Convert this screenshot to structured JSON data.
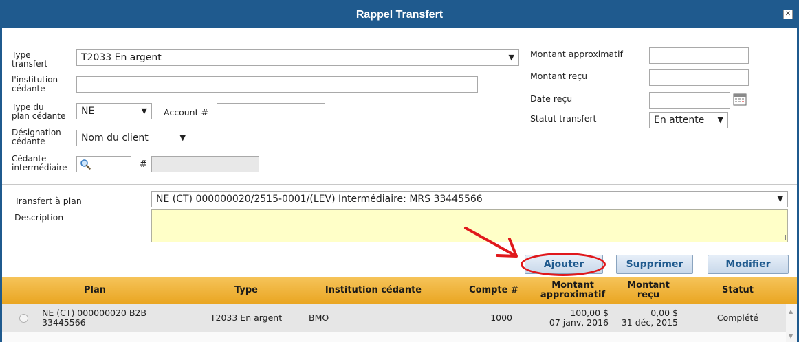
{
  "dialog": {
    "title": "Rappel Transfert",
    "close_glyph": "✕"
  },
  "form": {
    "type_transfert": {
      "label1": "Type",
      "label2": "transfert",
      "value": "T2033 En argent"
    },
    "institution_cedante": {
      "label1": "l'institution",
      "label2": "cédante",
      "value": ""
    },
    "type_plan_cedante": {
      "label1": "Type du",
      "label2": "plan cédante",
      "value": "NE"
    },
    "account": {
      "label": "Account #",
      "value": ""
    },
    "designation_cedante": {
      "label1": "Désignation",
      "label2": "cédante",
      "value": "Nom du client"
    },
    "cedante_intermediaire": {
      "label1": "Cédante",
      "label2": "intermédiaire",
      "hash": "#",
      "value": "",
      "number": ""
    },
    "montant_approximatif": {
      "label": "Montant approximatif",
      "value": ""
    },
    "montant_recu": {
      "label": "Montant reçu",
      "value": ""
    },
    "date_recu": {
      "label": "Date reçu",
      "value": ""
    },
    "statut_transfert": {
      "label": "Statut transfert",
      "value": "En attente"
    },
    "transfert_a_plan": {
      "label": "Transfert à plan",
      "value": "NE (CT) 000000020/2515-0001/(LEV) Intermédiaire: MRS 33445566"
    },
    "description": {
      "label": "Description",
      "value": ""
    }
  },
  "buttons": {
    "ajouter": "Ajouter",
    "supprimer": "Supprimer",
    "modifier": "Modifier"
  },
  "table": {
    "headers": {
      "plan": "Plan",
      "type": "Type",
      "institution": "Institution cédante",
      "compte": "Compte #",
      "montant_approx_1": "Montant",
      "montant_approx_2": "approximatif",
      "montant_recu_1": "Montant",
      "montant_recu_2": "reçu",
      "statut": "Statut"
    },
    "rows": [
      {
        "plan_1": "NE (CT) 000000020 B2B",
        "plan_2": "33445566",
        "type": "T2033 En argent",
        "institution": "BMO",
        "compte": "1000",
        "montant_approx_1": "100,00 $",
        "montant_approx_2": "07 janv, 2016",
        "montant_recu_1": "0,00 $",
        "montant_recu_2": "31 déc, 2015",
        "statut": "Complété"
      }
    ]
  },
  "colors": {
    "titlebar": "#1f5a8e",
    "header_gold": "#e9a521",
    "annotation_red": "#e0181c",
    "description_bg": "#ffffc8"
  }
}
